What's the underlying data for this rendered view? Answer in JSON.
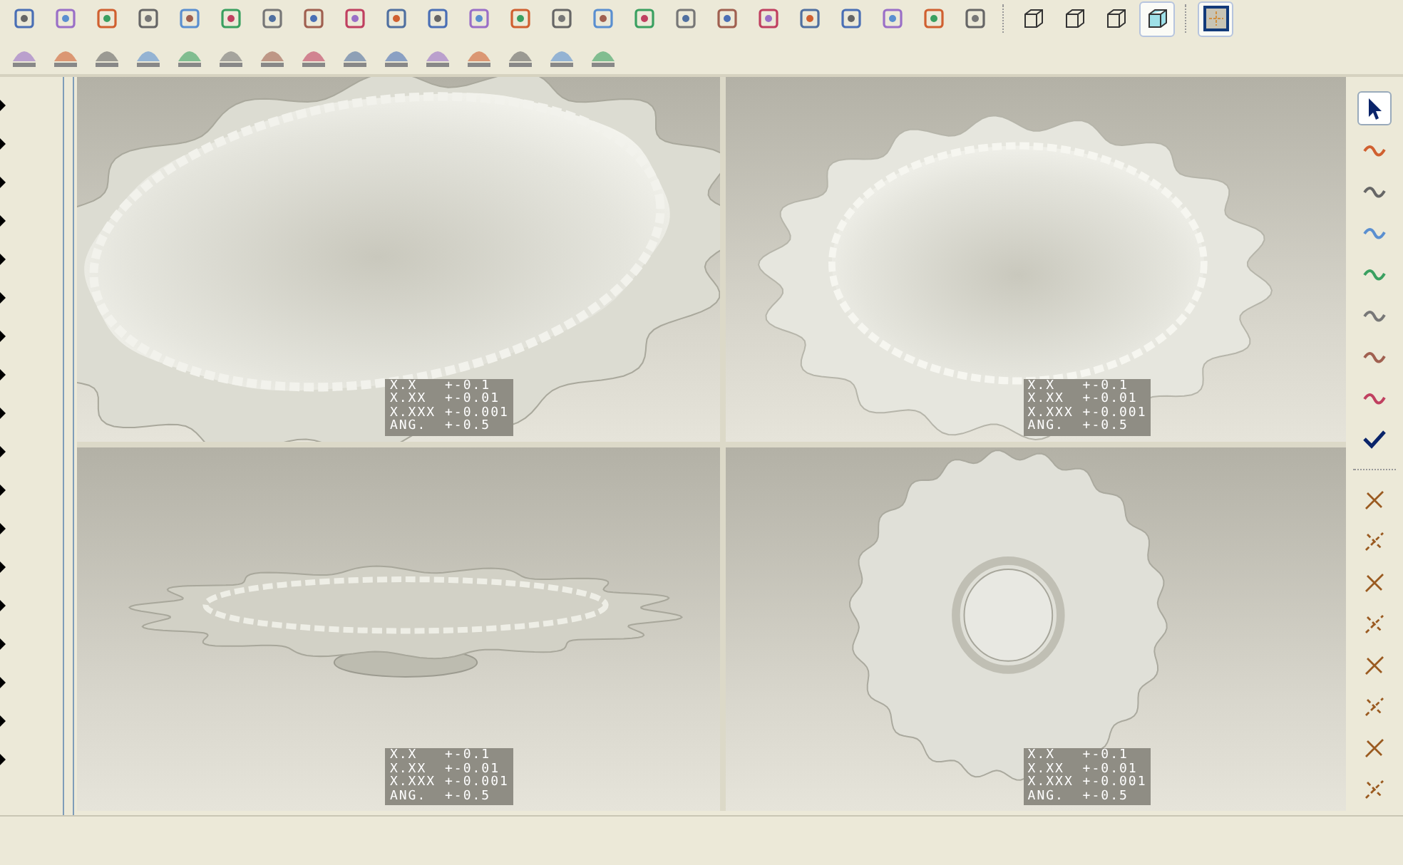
{
  "display_styles": [
    {
      "selected": false
    },
    {
      "selected": false
    },
    {
      "selected": false
    },
    {
      "selected": true
    }
  ],
  "right_tools": [
    {
      "selected": true
    },
    {
      "selected": false
    },
    {
      "selected": false
    },
    {
      "selected": false
    },
    {
      "selected": false
    },
    {
      "selected": false
    },
    {
      "selected": false
    },
    {
      "selected": false
    },
    {
      "selected": false
    }
  ],
  "viewports": [
    {
      "kind": "iso",
      "tolerances": [
        "X.X   +-0.1",
        "X.XX  +-0.01",
        "X.XXX +-0.001",
        "ANG.  +-0.5"
      ]
    },
    {
      "kind": "shaded",
      "tolerances": [
        "X.X   +-0.1",
        "X.XX  +-0.01",
        "X.XXX +-0.001",
        "ANG.  +-0.5"
      ]
    },
    {
      "kind": "side",
      "tolerances": [
        "X.X   +-0.1",
        "X.XX  +-0.01",
        "X.XXX +-0.001",
        "ANG.  +-0.5"
      ]
    },
    {
      "kind": "top",
      "tolerances": [
        "X.X   +-0.1",
        "X.XX  +-0.01",
        "X.XXX +-0.001",
        "ANG.  +-0.5"
      ]
    }
  ]
}
